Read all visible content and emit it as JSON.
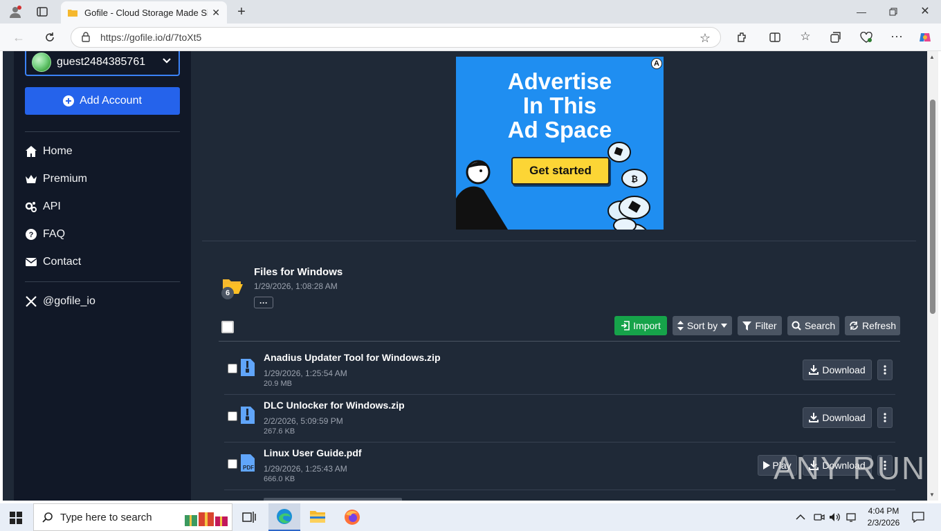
{
  "browser": {
    "tab_title": "Gofile - Cloud Storage Made Simp",
    "url": "https://gofile.io/d/7toXt5"
  },
  "sidebar": {
    "account_name": "guest2484385761",
    "add_account_label": "Add Account",
    "nav": [
      {
        "label": "Home",
        "icon": "home-icon"
      },
      {
        "label": "Premium",
        "icon": "crown-icon"
      },
      {
        "label": "API",
        "icon": "gears-icon"
      },
      {
        "label": "FAQ",
        "icon": "question-circle-icon"
      },
      {
        "label": "Contact",
        "icon": "envelope-icon"
      }
    ],
    "social_label": "@gofile_io"
  },
  "ad": {
    "headline_1": "Advertise",
    "headline_2": "In This",
    "headline_3": "Ad Space",
    "cta": "Get started"
  },
  "folder": {
    "name": "Files for Windows",
    "date": "1/29/2026, 1:08:28 AM",
    "count": "6",
    "more_label": "···"
  },
  "toolbar": {
    "import": "Import",
    "sort": "Sort by",
    "filter": "Filter",
    "search": "Search",
    "refresh": "Refresh"
  },
  "files": [
    {
      "name": "Anadius Updater Tool for Windows.zip",
      "date": "1/29/2026, 1:25:54 AM",
      "size": "20.9 MB",
      "type": "zip",
      "download": "Download"
    },
    {
      "name": "DLC Unlocker for Windows.zip",
      "date": "2/2/2026, 5:09:59 PM",
      "size": "267.6 KB",
      "type": "zip",
      "download": "Download"
    },
    {
      "name": "Linux User Guide.pdf",
      "date": "1/29/2026, 1:25:43 AM",
      "size": "666.0 KB",
      "type": "pdf",
      "download": "Download",
      "play": "Play"
    }
  ],
  "watermark": "ANY RUN",
  "taskbar": {
    "search_placeholder": "Type here to search",
    "time": "4:04 PM",
    "date": "2/3/2026"
  },
  "colors": {
    "page_bg": "#1f2937",
    "sidebar_bg": "#111827",
    "accent_blue": "#2563eb",
    "import_green": "#16a34a",
    "ad_blue": "#1f8ef1"
  }
}
